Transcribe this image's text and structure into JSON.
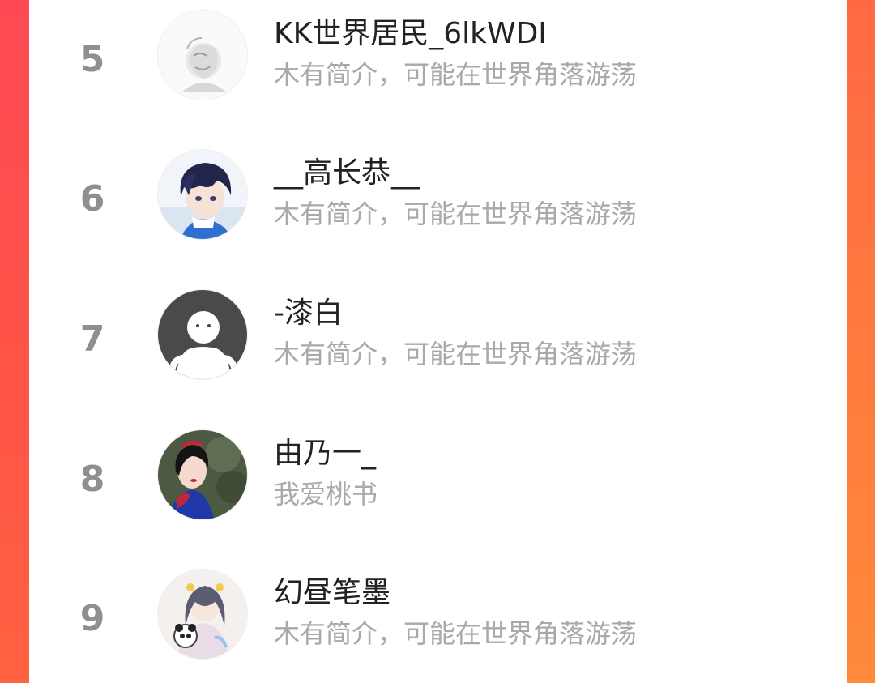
{
  "colors": {
    "rank_gray": "#8f8f8f",
    "name_text": "#222222",
    "bio_text": "#a9a9a9",
    "side_left": "#ff4a55",
    "side_right": "#ff7d3c"
  },
  "ranking": [
    {
      "rank": "5",
      "name": "KK世界居民_6lkWDI",
      "bio": "木有简介，可能在世界角落游荡",
      "avatar": "sketch-avatar-icon"
    },
    {
      "rank": "6",
      "name": "__高长恭__",
      "bio": "木有简介，可能在世界角落游荡",
      "avatar": "anime-boy-avatar-icon"
    },
    {
      "rank": "7",
      "name": "-漆白",
      "bio": "木有简介，可能在世界角落游荡",
      "avatar": "default-user-avatar-icon"
    },
    {
      "rank": "8",
      "name": "由乃一_",
      "bio": "我爱桃书",
      "avatar": "snow-white-avatar-icon"
    },
    {
      "rank": "9",
      "name": "幻昼笔墨",
      "bio": "木有简介，可能在世界角落游荡",
      "avatar": "anime-girl-panda-avatar-icon"
    }
  ]
}
